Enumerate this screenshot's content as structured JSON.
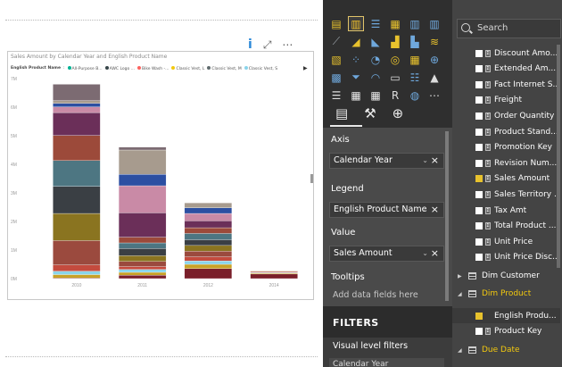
{
  "chart": {
    "title": "Sales Amount by Calendar Year and English Product Name",
    "legend_title": "English Product Name",
    "legend_items": [
      {
        "label": "All-Purpose B...",
        "color": "#00b294"
      },
      {
        "label": "AWC Logo ...",
        "color": "#374649"
      },
      {
        "label": "Bike Wash -...",
        "color": "#fd625e"
      },
      {
        "label": "Classic Vest, L",
        "color": "#f2c80f"
      },
      {
        "label": "Classic Vest, M",
        "color": "#5f6b6d"
      },
      {
        "label": "Classic Vest, S",
        "color": "#8ad4eb"
      }
    ]
  },
  "chart_data": {
    "type": "bar",
    "stacked": true,
    "categories": [
      "2010",
      "2011",
      "2012",
      "2014"
    ],
    "totals": [
      6.8,
      4.5,
      2.25,
      0.27
    ],
    "ylim": [
      0,
      7
    ],
    "yticks": [
      "0M",
      "1M",
      "2M",
      "3M",
      "4M",
      "5M",
      "6M",
      "7M"
    ],
    "series": [
      {
        "color": "#7a1f2a",
        "values": [
          0.02,
          0.12,
          0.35,
          0.16
        ]
      },
      {
        "color": "#c9a227",
        "values": [
          0.12,
          0.1,
          0.15,
          0.03
        ]
      },
      {
        "color": "#8ad4eb",
        "values": [
          0.12,
          0.1,
          0.12,
          0.02
        ]
      },
      {
        "color": "#c44b3e",
        "values": [
          0.22,
          0.1,
          0.14,
          0.03
        ]
      },
      {
        "color": "#9b4a3e",
        "values": [
          0.85,
          0.18,
          0.2,
          0.02
        ]
      },
      {
        "color": "#8a7420",
        "values": [
          0.95,
          0.2,
          0.2,
          0.01
        ]
      },
      {
        "color": "#3a3f44",
        "values": [
          0.95,
          0.25,
          0.2,
          0.0
        ]
      },
      {
        "color": "#4d7682",
        "values": [
          0.9,
          0.2,
          0.22,
          0.0
        ]
      },
      {
        "color": "#9c4a3a",
        "values": [
          0.88,
          0.2,
          0.2,
          0.0
        ]
      },
      {
        "color": "#6b2f59",
        "values": [
          0.8,
          0.85,
          0.24,
          0.0
        ]
      },
      {
        "color": "#c98aa6",
        "values": [
          0.2,
          0.95,
          0.26,
          0.0
        ]
      },
      {
        "color": "#2c4fa2",
        "values": [
          0.12,
          0.4,
          0.2,
          0.0
        ]
      },
      {
        "color": "#a79b8e",
        "values": [
          0.1,
          0.85,
          0.17,
          0.0
        ]
      },
      {
        "color": "#7c6b72",
        "values": [
          0.57,
          0.1,
          0.0,
          0.0
        ]
      }
    ]
  },
  "viz_icons": [
    "stacked-bar",
    "stacked-column",
    "clustered-bar",
    "clustered-column",
    "100-bar",
    "100-column",
    "line",
    "area",
    "stacked-area",
    "line-column",
    "line-clustered",
    "ribbon",
    "waterfall",
    "scatter",
    "pie",
    "donut",
    "treemap",
    "map",
    "filled-map",
    "funnel",
    "gauge",
    "card",
    "multi-row-card",
    "kpi",
    "slicer",
    "table",
    "matrix",
    "r-visual",
    "globe",
    "more"
  ],
  "panes": {
    "axis_label": "Axis",
    "axis_value": "Calendar Year",
    "legend_label": "Legend",
    "legend_value": "English Product Name",
    "value_label": "Value",
    "value_value": "Sales Amount",
    "tooltips_label": "Tooltips",
    "tooltips_placeholder": "Add data fields here",
    "filters_title": "FILTERS",
    "visual_filters_label": "Visual level filters",
    "visual_filter_value": "Calendar Year"
  },
  "fields": {
    "search_placeholder": "Search",
    "items": [
      {
        "label": "Discount Amo...",
        "checked": false
      },
      {
        "label": "Extended Am...",
        "checked": false
      },
      {
        "label": "Fact Internet S...",
        "checked": false
      },
      {
        "label": "Freight",
        "checked": false
      },
      {
        "label": "Order Quantity",
        "checked": false
      },
      {
        "label": "Product Stand...",
        "checked": false
      },
      {
        "label": "Promotion Key",
        "checked": false
      },
      {
        "label": "Revision Num...",
        "checked": false
      },
      {
        "label": "Sales Amount",
        "checked": true
      },
      {
        "label": "Sales Territory ...",
        "checked": false
      },
      {
        "label": "Tax Amt",
        "checked": false
      },
      {
        "label": "Total Product ...",
        "checked": false
      },
      {
        "label": "Unit Price",
        "checked": false
      },
      {
        "label": "Unit Price Disc...",
        "checked": false
      }
    ],
    "dim_customer": "Dim Customer",
    "dim_product": "Dim Product",
    "dim_product_fields": [
      {
        "label": "English Produ...",
        "checked": true
      },
      {
        "label": "Product Key",
        "checked": false
      }
    ],
    "due_date": "Due Date"
  },
  "colors": {
    "accent": "#e8c22d",
    "dim_highlight": "#f2c80f",
    "link_blue": "#2b88d8"
  }
}
